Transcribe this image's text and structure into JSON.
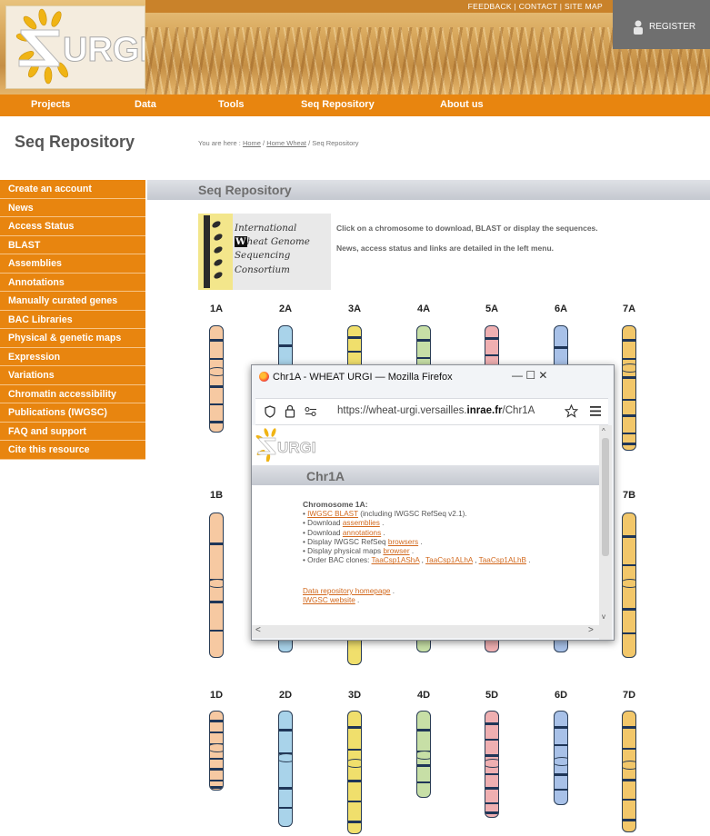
{
  "header": {
    "toplinks": "FEEDBACK  |  CONTACT  |  SITE MAP",
    "register_label": "REGISTER"
  },
  "nav": [
    "Projects",
    "Data",
    "Tools",
    "Seq Repository",
    "About us"
  ],
  "page_title": "Seq Repository",
  "breadcrumb": {
    "prefix": "You are here : ",
    "home": "Home",
    "sep1": " / ",
    "home_wheat": "Home Wheat",
    "sep2": " / ",
    "current": "Seq Repository"
  },
  "sidebar": [
    "Create an account",
    "News",
    "Access Status",
    "BLAST",
    "Assemblies",
    "Annotations",
    "Manually curated genes",
    "BAC Libraries",
    "Physical & genetic maps",
    "Expression",
    "Variations",
    "Chromatin accessibility",
    "Publications (IWGSC)",
    "FAQ and support",
    "Cite this resource"
  ],
  "section_title": "Seq Repository",
  "iwgsc_logo": {
    "line1": "International",
    "line2_w": "W",
    "line2": "heat Genome",
    "line3": "Sequencing",
    "line4": "Consortium"
  },
  "intro": {
    "line1": "Click on a chromosome to download, BLAST or display the sequences.",
    "line2": "News, access status and links are detailed in the left menu."
  },
  "chromosomes": {
    "row1": [
      "1A",
      "2A",
      "3A",
      "4A",
      "5A",
      "6A",
      "7A"
    ],
    "row2": [
      "1B",
      "7B"
    ],
    "row3": [
      "1D",
      "2D",
      "3D",
      "4D",
      "5D",
      "6D",
      "7D"
    ],
    "colors": {
      "1": "#f6c9a2",
      "2": "#a9d3ea",
      "3": "#f0df6c",
      "4": "#c7dfa6",
      "5": "#efafb1",
      "6": "#a8c1e8",
      "7": "#f2c76a"
    }
  },
  "popup": {
    "window_title": "Chr1A - WHEAT URGI — Mozilla Firefox",
    "win_controls": "—     ☐     ✕",
    "url_prefix": "https://wheat-urgi.versailles.",
    "url_bold": "inrae.fr",
    "url_suffix": "/Chr1A",
    "logo_text": "URGI",
    "title": "Chr1A",
    "chrom_heading": "Chromosome 1A:",
    "items": [
      {
        "bullet": "• ",
        "link": "IWGSC BLAST",
        "tail": " (including IWGSC RefSeq v2.1)."
      },
      {
        "bullet": "• ",
        "pre": "Download ",
        "link": "assemblies",
        "tail": " ."
      },
      {
        "bullet": "• ",
        "pre": "Download ",
        "link": "annotations",
        "tail": " ."
      },
      {
        "bullet": "• ",
        "pre": "Display IWGSC RefSeq ",
        "link": "browsers",
        "tail": " ."
      },
      {
        "bullet": "• ",
        "pre": "Display physical maps ",
        "link": "browser",
        "tail": " ."
      },
      {
        "bullet": "• ",
        "pre": "Order BAC clones: ",
        "link": "TaaCsp1AShA",
        "mid1": " , ",
        "link2": "TaaCsp1ALhA",
        "mid2": " , ",
        "link3": "TaaCsp1ALhB",
        "tail": " ."
      }
    ],
    "footer_link1": "Data repository homepage",
    "footer_tail1": " .",
    "footer_link2": "IWGSC website",
    "footer_tail2": " ."
  }
}
